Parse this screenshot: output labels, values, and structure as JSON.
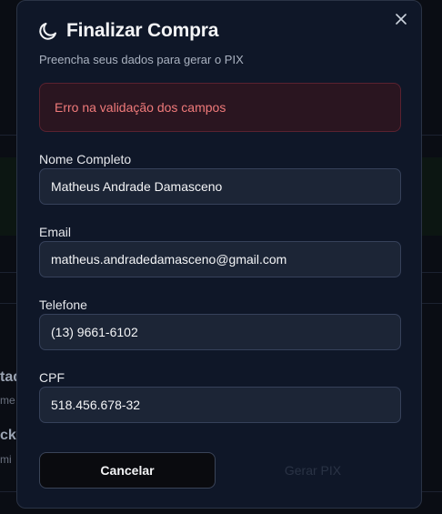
{
  "background": {
    "fragments": [
      "tad",
      "me",
      "ckl",
      "mi"
    ]
  },
  "modal": {
    "title": "Finalizar Compra",
    "title_icon": "moon-icon",
    "subtitle": "Preencha seus dados para gerar o PIX",
    "close_icon": "close-icon",
    "error_message": "Erro na validação dos campos",
    "fields": {
      "name": {
        "label": "Nome Completo",
        "value": "Matheus Andrade Damasceno"
      },
      "email": {
        "label": "Email",
        "value": "matheus.andradedamasceno@gmail.com"
      },
      "phone": {
        "label": "Telefone",
        "value": "(13) 9661-6102"
      },
      "cpf": {
        "label": "CPF",
        "value": "518.456.678-32"
      }
    },
    "buttons": {
      "cancel": "Cancelar",
      "generate": "Gerar PIX"
    }
  },
  "colors": {
    "modal_bg": "#0f1728",
    "error_text": "#f07a7a",
    "field_bg": "#1c2536"
  }
}
